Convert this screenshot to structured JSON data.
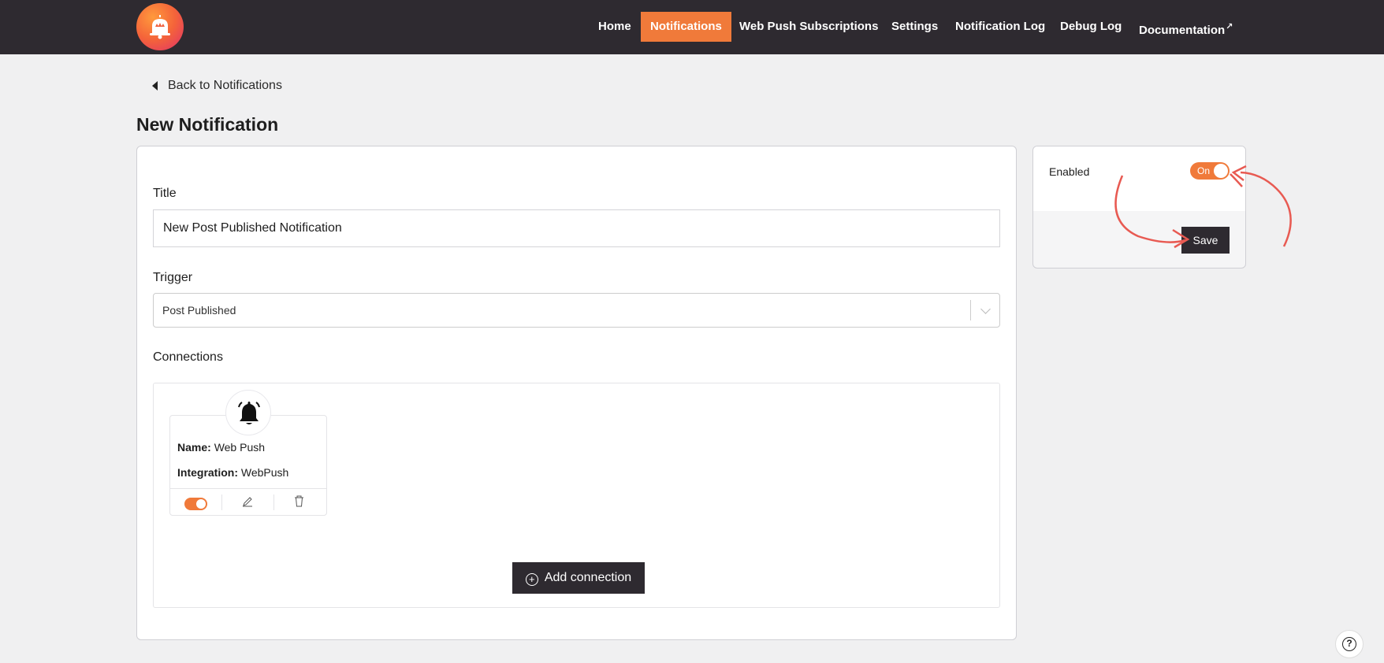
{
  "header": {
    "logo_icon": "bell-crown-logo-icon",
    "nav": [
      {
        "label": "Home",
        "active": false
      },
      {
        "label": "Notifications",
        "active": true
      },
      {
        "label": "Web Push Subscriptions",
        "active": false
      },
      {
        "label": "Settings",
        "active": false
      },
      {
        "label": "Notification Log",
        "active": false
      },
      {
        "label": "Debug Log",
        "active": false
      },
      {
        "label": "Documentation",
        "active": false,
        "external_icon": "↗"
      }
    ],
    "accent_color": "#f07a3a",
    "bar_color": "#2e2a30"
  },
  "back_link": {
    "label": "Back to Notifications"
  },
  "page_title": "New Notification",
  "form": {
    "title_label": "Title",
    "title_value": "New Post Published Notification",
    "trigger_label": "Trigger",
    "trigger_value": "Post Published",
    "connections_label": "Connections",
    "connection": {
      "icon": "bell-icon",
      "name_label": "Name:",
      "name_value": "Web Push",
      "integration_label": "Integration:",
      "integration_value": "WebPush",
      "enabled": true
    },
    "add_connection_label": "Add connection"
  },
  "side": {
    "enabled_label": "Enabled",
    "toggle_text": "On",
    "save_label": "Save"
  },
  "help_icon": "help-question-icon"
}
